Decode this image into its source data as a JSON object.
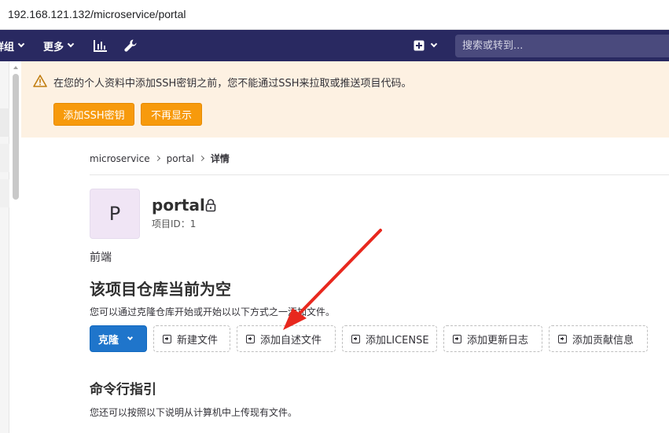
{
  "browser": {
    "url": "192.168.121.132/microservice/portal"
  },
  "topnav": {
    "groups_label": "群组",
    "more_label": "更多",
    "search_placeholder": "搜索或转到..."
  },
  "alert": {
    "message": "在您的个人资料中添加SSH密钥之前，您不能通过SSH来拉取或推送项目代码。",
    "add_ssh_label": "添加SSH密钥",
    "dismiss_label": "不再显示"
  },
  "breadcrumb": {
    "group": "microservice",
    "project": "portal",
    "current": "详情"
  },
  "project": {
    "avatar_letter": "P",
    "name": "portal",
    "id_text": "项目ID：1",
    "description": "前端"
  },
  "empty_repo": {
    "title": "该项目仓库当前为空",
    "hint": "您可以通过克隆仓库开始或开始以以下方式之一添加文件。",
    "clone_label": "克隆",
    "actions": [
      "新建文件",
      "添加自述文件",
      "添加LICENSE",
      "添加更新日志",
      "添加贡献信息"
    ]
  },
  "cli": {
    "title": "命令行指引",
    "hint": "您还可以按照以下说明从计算机中上传现有文件。"
  },
  "colors": {
    "nav": "#292961",
    "accent_orange": "#f79a0c",
    "primary_blue": "#1f75cb",
    "annotation_red": "#e8281e"
  }
}
